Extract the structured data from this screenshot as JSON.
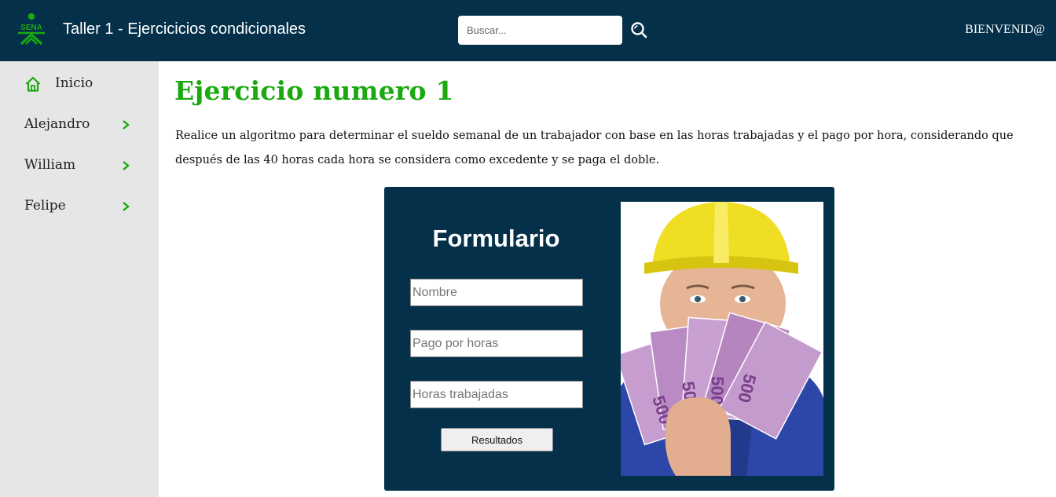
{
  "header": {
    "title": "Taller 1 - Ejercicicios condicionales",
    "logo_icon": "sena-logo-icon",
    "search": {
      "placeholder": "Buscar...",
      "value": "",
      "icon": "search-icon"
    },
    "welcome": "BIENVENID@"
  },
  "sidebar": {
    "items": [
      {
        "label": "Inicio",
        "icon": "home-icon"
      },
      {
        "label": "Alejandro",
        "icon": "chevron-right-icon"
      },
      {
        "label": "William",
        "icon": "chevron-right-icon"
      },
      {
        "label": "Felipe",
        "icon": "chevron-right-icon"
      }
    ]
  },
  "main": {
    "title": "Ejercicio numero 1",
    "description": "Realice un algoritmo para determinar el sueldo semanal de un trabajador con base en las horas trabajadas y el pago por hora, considerando que después de las 40 horas cada hora se considera como excedente y se paga el doble."
  },
  "form": {
    "title": "Formulario",
    "fields": [
      {
        "placeholder": "Nombre",
        "value": ""
      },
      {
        "placeholder": "Pago por horas",
        "value": ""
      },
      {
        "placeholder": "Horas trabajadas",
        "value": ""
      }
    ],
    "submit_label": "Resultados",
    "image": "worker-with-money-image"
  },
  "colors": {
    "header_bg": "#04304a",
    "accent_green": "#1aa90f",
    "sidebar_bg": "#e6e6e6",
    "card_bg": "#04304a"
  }
}
